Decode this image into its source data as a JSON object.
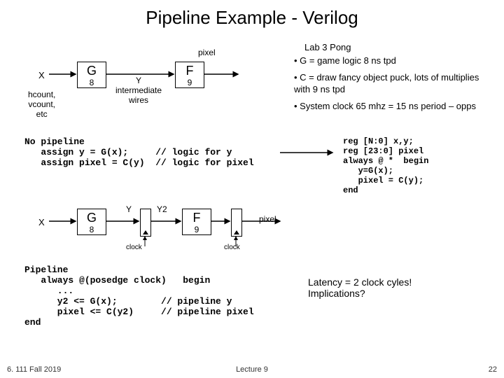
{
  "title": "Pipeline Example - Verilog",
  "diagram1": {
    "x_label": "X",
    "subx": "hcount,\nvcount,\netc",
    "g": "G",
    "g_n": "8",
    "y_label": "Y\nintermediate\nwires",
    "f": "F",
    "f_n": "9",
    "pixel": "pixel"
  },
  "lab": {
    "heading": "Lab 3 Pong",
    "b1": "G = game logic 8 ns tpd",
    "b2": "C = draw fancy object puck, lots of multiplies  with  9 ns tpd",
    "b3": "System clock 65 mhz = 15 ns period – opps"
  },
  "code1": "No pipeline\n   assign y = G(x);     // logic for y\n   assign pixel = C(y)  // logic for pixel",
  "code_reg": "reg [N:0] x,y;\nreg [23:0] pixel\nalways @ *  begin\n   y=G(x);\n   pixel = C(y);\nend",
  "diagram2": {
    "x_label": "X",
    "g": "G",
    "g_n": "8",
    "y": "Y",
    "y2": "Y2",
    "f": "F",
    "f_n": "9",
    "pixel": "pixel",
    "clock": "clock"
  },
  "code2": "Pipeline\n   always @(posedge clock)   begin\n      ...\n      y2 <= G(x);        // pipeline y\n      pixel <= C(y2)     // pipeline pixel\nend",
  "latency": "Latency = 2 clock cyles!\nImplications?",
  "footer": {
    "left": "6. 111 Fall 2019",
    "center": "Lecture 9",
    "right": "22"
  }
}
